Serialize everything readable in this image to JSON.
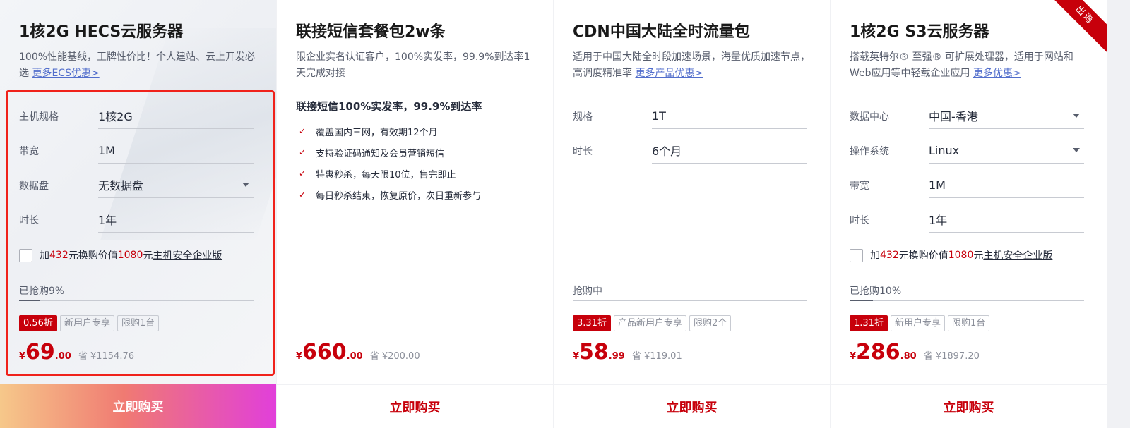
{
  "colors": {
    "accent": "#c7000b",
    "link": "#526ecc",
    "highlight": "#f0221b"
  },
  "cards": [
    {
      "title": "1核2G HECS云服务器",
      "desc": "100%性能基线，王牌性价比！个人建站、云上开发必选",
      "link": "更多ECS优惠>",
      "specs": [
        {
          "label": "主机规格",
          "value": "1核2G"
        },
        {
          "label": "带宽",
          "value": "1M"
        },
        {
          "label": "数据盘",
          "value": "无数据盘"
        },
        {
          "label": "时长",
          "value": "1年"
        }
      ],
      "addon": {
        "prefix": "加",
        "amount": "432",
        "mid": "元换购价值",
        "worth": "1080",
        "suffix": "元",
        "product": "主机安全企业版"
      },
      "progress": {
        "text": "已抢购9%",
        "percent": 9
      },
      "tags": {
        "discount": "0.56折",
        "t1": "新用户专享",
        "t2": "限购1台"
      },
      "price": {
        "currency": "¥",
        "int": "69",
        "dec": ".00",
        "save": "省 ¥1154.76"
      },
      "buy": "立即购买"
    },
    {
      "title": "联接短信套餐包2w条",
      "desc": "限企业实名认证客户，100%实发率，99.9%到达率1天完成对接",
      "features_head": "联接短信100%实发率，99.9%到达率",
      "features": [
        "覆盖国内三网，有效期12个月",
        "支持验证码通知及会员营销短信",
        "特惠秒杀，每天限10位，售完即止",
        "每日秒杀结束，恢复原价，次日重新参与"
      ],
      "price": {
        "currency": "¥",
        "int": "660",
        "dec": ".00",
        "save": "省 ¥200.00"
      },
      "buy": "立即购买"
    },
    {
      "title": "CDN中国大陆全时流量包",
      "desc": "适用于中国大陆全时段加速场景，海量优质加速节点，高调度精准率",
      "link": "更多产品优惠>",
      "specs": [
        {
          "label": "规格",
          "value": "1T"
        },
        {
          "label": "时长",
          "value": "6个月"
        }
      ],
      "progress": {
        "text": "抢购中",
        "percent": 0
      },
      "tags": {
        "discount": "3.31折",
        "t1": "产品新用户专享",
        "t2": "限购2个"
      },
      "price": {
        "currency": "¥",
        "int": "58",
        "dec": ".99",
        "save": "省 ¥119.01"
      },
      "buy": "立即购买"
    },
    {
      "title": "1核2G S3云服务器",
      "corner": "出海",
      "desc": "搭载英特尔® 至强® 可扩展处理器，适用于网站和Web应用等中轻载企业应用",
      "link": "更多优惠>",
      "specs": [
        {
          "label": "数据中心",
          "value": "中国-香港"
        },
        {
          "label": "操作系统",
          "value": "Linux"
        },
        {
          "label": "带宽",
          "value": "1M"
        },
        {
          "label": "时长",
          "value": "1年"
        }
      ],
      "addon": {
        "prefix": "加",
        "amount": "432",
        "mid": "元换购价值",
        "worth": "1080",
        "suffix": "元",
        "product": "主机安全企业版"
      },
      "progress": {
        "text": "已抢购10%",
        "percent": 10
      },
      "tags": {
        "discount": "1.31折",
        "t1": "新用户专享",
        "t2": "限购1台"
      },
      "price": {
        "currency": "¥",
        "int": "286",
        "dec": ".80",
        "save": "省 ¥1897.20"
      },
      "buy": "立即购买"
    }
  ]
}
